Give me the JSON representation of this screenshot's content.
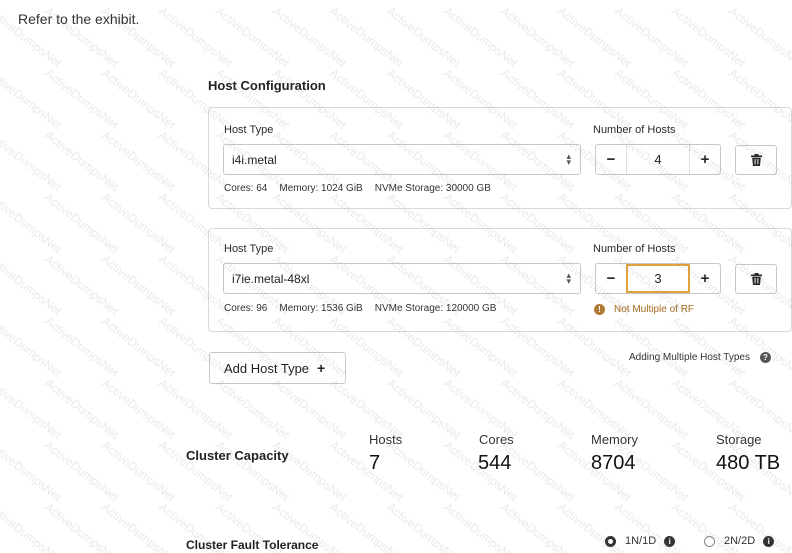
{
  "intro": "Refer to the exhibit.",
  "host_config": {
    "title": "Host Configuration",
    "rows": [
      {
        "host_type_label": "Host Type",
        "host_type": "i4i.metal",
        "hosts_label": "Number of Hosts",
        "hosts": "4",
        "cores": "Cores: 64",
        "memory": "Memory: 1024 GiB",
        "storage": "NVMe Storage: 30000 GB"
      },
      {
        "host_type_label": "Host Type",
        "host_type": "i7ie.metal-48xl",
        "hosts_label": "Number of Hosts",
        "hosts": "3",
        "cores": "Cores: 96",
        "memory": "Memory: 1536 GiB",
        "storage": "NVMe Storage: 120000 GB",
        "warning": "Not Multiple of RF"
      }
    ],
    "stepper_minus": "−",
    "stepper_plus": "+",
    "add_label": "Add Host Type",
    "add_plus": "+",
    "multi_label": "Adding Multiple Host Types"
  },
  "capacity": {
    "title": "Cluster Capacity",
    "hosts_label": "Hosts",
    "hosts": "7",
    "cores_label": "Cores",
    "cores": "544",
    "memory_label": "Memory",
    "memory": "8704",
    "storage_label": "Storage",
    "storage": "480 TB"
  },
  "fault_tolerance": {
    "title": "Cluster Fault Tolerance",
    "options": [
      {
        "label": "1N/1D",
        "selected": true
      },
      {
        "label": "2N/2D",
        "selected": false
      }
    ]
  },
  "watermark": "ActiveDumpsNet",
  "colors": {
    "warning": "#a56a1f",
    "focus_border": "#e0a33b"
  }
}
